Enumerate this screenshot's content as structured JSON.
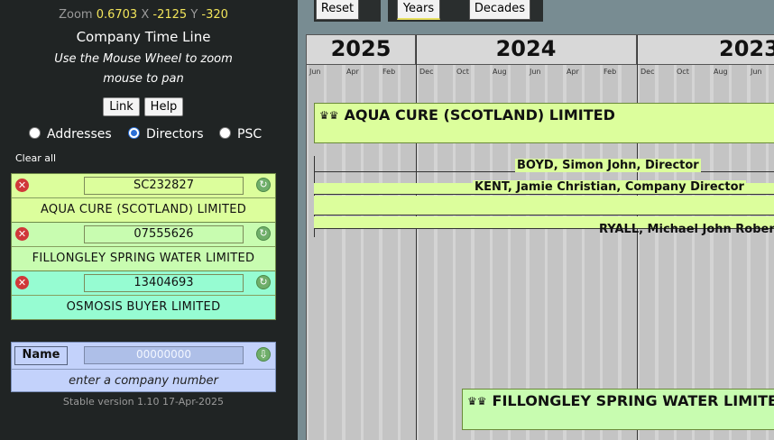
{
  "zoom": {
    "zoom_label": "Zoom",
    "zoom_value": "0.6703",
    "x_label": "X",
    "x_value": "-2125",
    "y_label": "Y",
    "y_value": "-320"
  },
  "app": {
    "title": "Company Time Line",
    "hint_line1": "Use the Mouse Wheel to zoom",
    "hint_line2": "mouse to pan"
  },
  "buttons": {
    "link": "Link",
    "help": "Help"
  },
  "modes": {
    "addresses": "Addresses",
    "directors": "Directors",
    "psc": "PSC",
    "selected": "directors"
  },
  "clear_all": "Clear all",
  "companies": [
    {
      "number": "SC232827",
      "name": "AQUA CURE (SCOTLAND) LIMITED",
      "color": "#dcfe9c"
    },
    {
      "number": "07555626",
      "name": "FILLONGLEY SPRING WATER LIMITED",
      "color": "#c8fcb0"
    },
    {
      "number": "13404693",
      "name": "OSMOSIS BUYER LIMITED",
      "color": "#96fcd2"
    }
  ],
  "new_company": {
    "name_label": "Name",
    "placeholder": "00000000",
    "prompt": "enter a company number"
  },
  "version": "Stable version 1.10 17-Apr-2025",
  "tabs": {
    "reset": "Reset",
    "years": "Years",
    "decades": "Decades"
  },
  "timeline": {
    "years": [
      "2025",
      "2024",
      "2023"
    ],
    "months_2025": [
      "Jun",
      "Apr",
      "Feb"
    ],
    "months_2024": [
      "Dec",
      "Oct",
      "Aug",
      "Jun",
      "Apr",
      "Feb"
    ],
    "months_2023": [
      "Dec",
      "Oct",
      "Aug",
      "Jun"
    ],
    "company_boxes": [
      {
        "name": "AQUA CURE (SCOTLAND) LIMITED",
        "icon": "crown-icon"
      },
      {
        "name": "FILLONGLEY SPRING WATER LIMITED",
        "icon": "crown-icon"
      }
    ],
    "directors": [
      "BOYD, Simon John, Director",
      "KENT, Jamie Christian, Company Director",
      "",
      "RYALL, Michael John Robert"
    ]
  }
}
